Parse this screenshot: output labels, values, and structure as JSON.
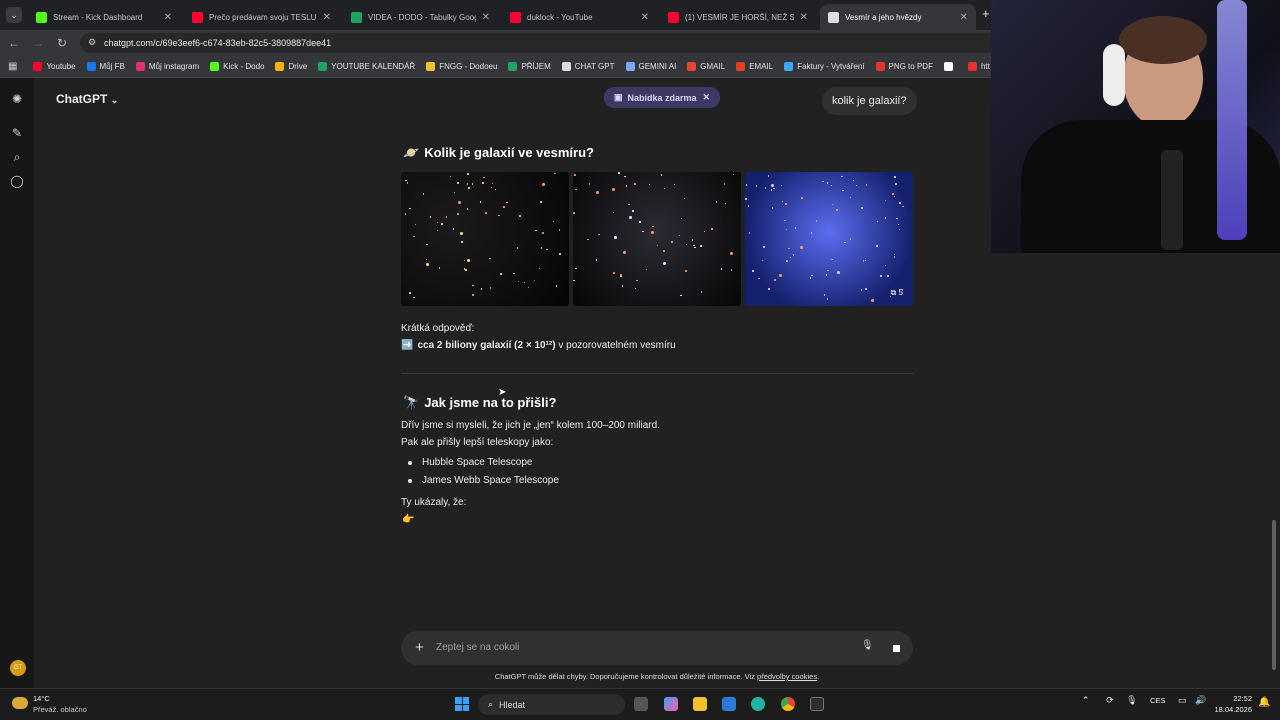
{
  "browser": {
    "tabs": [
      {
        "title": "Stream - Kick Dashboard",
        "favicon": "kick-icon",
        "color": "#53fc18",
        "active": false
      },
      {
        "title": "Prečo predávam svoju TESLU - ",
        "favicon": "youtube-icon",
        "color": "#ff0033",
        "active": false
      },
      {
        "title": "VIDEA - DODO - Tabulky Googl",
        "favicon": "sheets-icon",
        "color": "#1ea362",
        "active": false
      },
      {
        "title": "duklock - YouTube",
        "favicon": "youtube-icon",
        "color": "#ff0033",
        "active": false
      },
      {
        "title": "(1) VESMÍR JE HORŠÍ, NEŽ SI M",
        "favicon": "youtube-icon",
        "color": "#ff0033",
        "active": false
      },
      {
        "title": "Vesmír a jeho hvězdy",
        "favicon": "chatgpt-icon",
        "color": "#dddddd",
        "active": true
      }
    ],
    "new_tab": "+",
    "url": "chatgpt.com/c/69e3eef6-c674-83eb-82c5-3809887dee41",
    "bookmarks": [
      {
        "label": "Youtube",
        "icon": "youtube-icon",
        "color": "#ff0033"
      },
      {
        "label": "Můj FB",
        "icon": "facebook-icon",
        "color": "#1877f2"
      },
      {
        "label": "Můj instagram",
        "icon": "instagram-icon",
        "color": "#e1306c"
      },
      {
        "label": "Kick - Dodo",
        "icon": "kick-icon",
        "color": "#53fc18"
      },
      {
        "label": "Drive",
        "icon": "drive-icon",
        "color": "#f4b400"
      },
      {
        "label": "YOUTUBE KALENDÁŘ",
        "icon": "sheets-icon",
        "color": "#1ea362"
      },
      {
        "label": "FNGG - Dodoeu",
        "icon": "fngg-icon",
        "color": "#f2c12e"
      },
      {
        "label": "PŘÍJEM",
        "icon": "sheets-icon",
        "color": "#1ea362"
      },
      {
        "label": "CHAT GPT",
        "icon": "chatgpt-icon",
        "color": "#dddddd"
      },
      {
        "label": "GEMINI AI",
        "icon": "gemini-icon",
        "color": "#7aa7ff"
      },
      {
        "label": "GMAIL",
        "icon": "gmail-icon",
        "color": "#ea4335"
      },
      {
        "label": "EMAIL",
        "icon": "email-icon",
        "color": "#e2401c"
      },
      {
        "label": "Faktury - Vytváření",
        "icon": "faktury-icon",
        "color": "#3da8ff"
      },
      {
        "label": "PNG to PDF",
        "icon": "pdf-icon",
        "color": "#e5322d"
      },
      {
        "label": "",
        "icon": "bookmark-icon",
        "color": "#ffffff"
      },
      {
        "label": "htt",
        "icon": "heart-icon",
        "color": "#e5322d"
      }
    ]
  },
  "chat": {
    "model": "ChatGPT",
    "promo": "Nabídka zdarma",
    "user_message": "kolik je galaxií?",
    "heading1": "Kolik je galaxií ve vesmíru?",
    "heading1_emoji": "🪐",
    "image_count": "5",
    "short_answer_label": "Krátká odpověď:",
    "answer_arrow": "➡️",
    "answer_bold": "cca 2 biliony galaxií (2 × 10¹²)",
    "answer_rest": " v pozorovatelném vesmíru",
    "heading2": "Jak jsme na to přišli?",
    "heading2_emoji": "🔭",
    "para1": "Dřív jsme si mysleli, že jich je „jen“ kolem 100–200 miliard.",
    "para2": "Pak ale přišly lepší teleskopy jako:",
    "list": [
      "Hubble Space Telescope",
      "James Webb Space Telescope"
    ],
    "para3": "Ty ukázaly, že:",
    "pointing_emoji": "👉",
    "input_placeholder": "Zeptej se na cokoli",
    "disclaimer": "ChatGPT může dělat chyby. Doporučujeme kontrolovat důležité informace. Viz ",
    "disclaimer_link": "předvolby cookies",
    "disclaimer_end": "."
  },
  "taskbar": {
    "temperature": "14°C",
    "weather": "Převáž. oblačno",
    "search": "Hledat",
    "lang": "CES",
    "time": "22:52",
    "date": "18.04.2026"
  },
  "colors": {
    "accent": "#3b3963",
    "bg": "#212121",
    "sidebar": "#171717"
  }
}
